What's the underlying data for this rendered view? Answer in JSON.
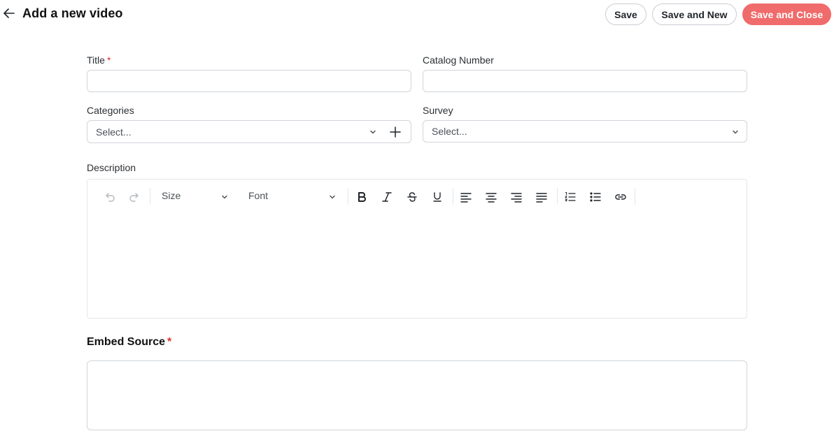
{
  "header": {
    "title": "Add a new video",
    "back_icon": "arrow-left-icon",
    "buttons": {
      "save": "Save",
      "save_new": "Save and New",
      "save_close": "Save and Close"
    }
  },
  "form": {
    "title_label": "Title",
    "title_value": "",
    "catalog_label": "Catalog Number",
    "catalog_value": "",
    "categories_label": "Categories",
    "categories_placeholder": "Select...",
    "survey_label": "Survey",
    "survey_placeholder": "Select...",
    "description_label": "Description",
    "required_mark": "*"
  },
  "editor": {
    "size_label": "Size",
    "font_label": "Font",
    "tools": [
      "undo-icon",
      "redo-icon",
      "bold-icon",
      "italic-icon",
      "strikethrough-icon",
      "underline-icon",
      "align-left-icon",
      "align-center-icon",
      "align-right-icon",
      "align-justify-icon",
      "ordered-list-icon",
      "bullet-list-icon",
      "link-icon"
    ]
  },
  "embed": {
    "label": "Embed Source",
    "value": ""
  },
  "colors": {
    "accent": "#f06b6b",
    "required": "#e03131",
    "border": "#d0d4d9"
  }
}
